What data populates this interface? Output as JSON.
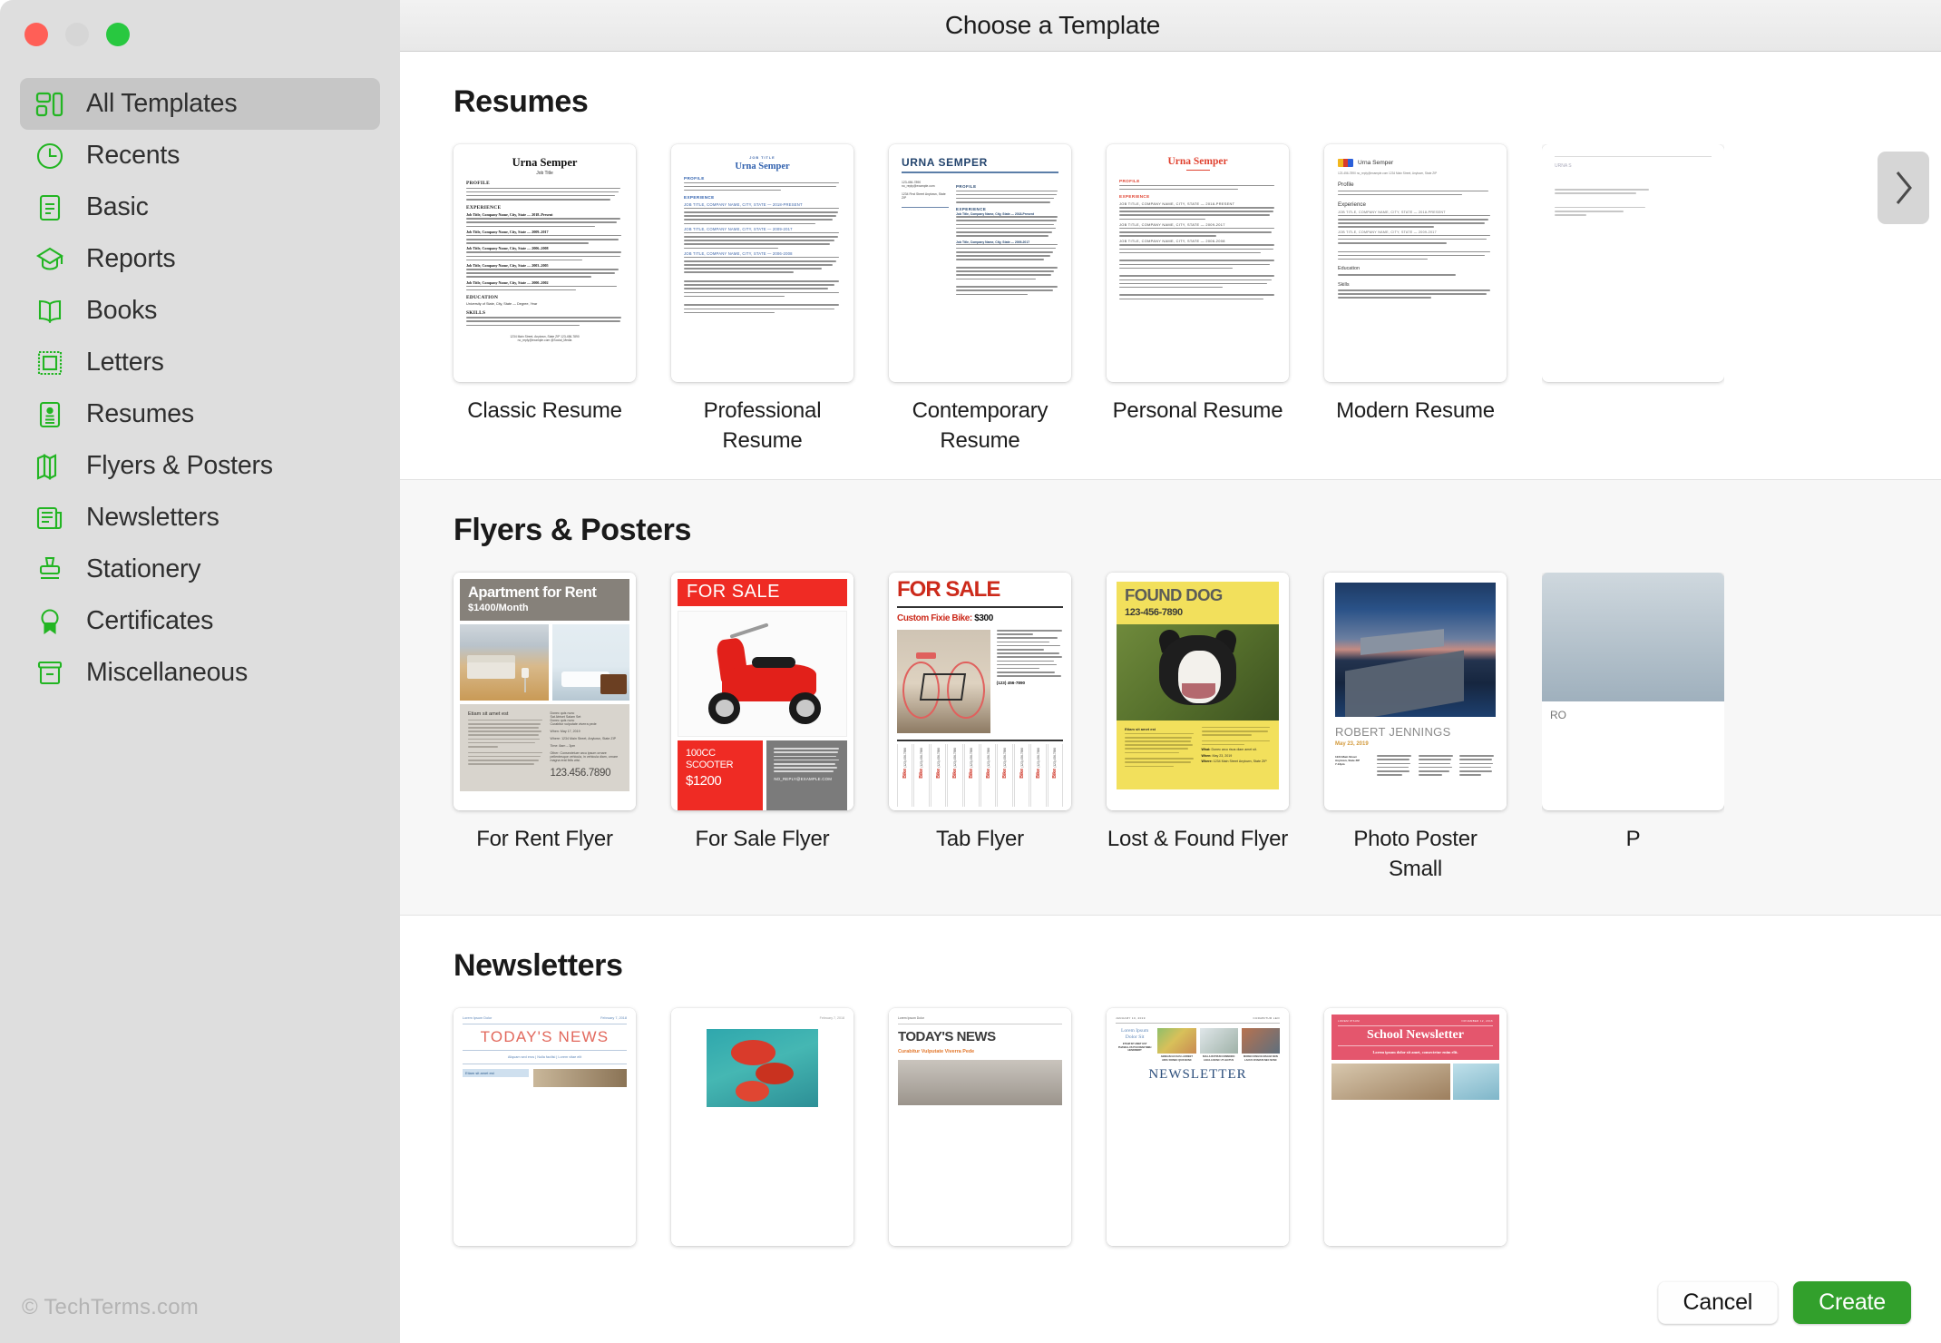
{
  "window": {
    "title": "Choose a Template",
    "traffic_lights": [
      "close",
      "minimize",
      "zoom"
    ],
    "watermark": "© TechTerms.com"
  },
  "sidebar": {
    "items": [
      {
        "label": "All Templates",
        "icon": "grid-icon",
        "active": true
      },
      {
        "label": "Recents",
        "icon": "clock-icon",
        "active": false
      },
      {
        "label": "Basic",
        "icon": "document-icon",
        "active": false
      },
      {
        "label": "Reports",
        "icon": "graduation-cap-icon",
        "active": false
      },
      {
        "label": "Books",
        "icon": "open-book-icon",
        "active": false
      },
      {
        "label": "Letters",
        "icon": "stamp-frame-icon",
        "active": false
      },
      {
        "label": "Resumes",
        "icon": "id-card-icon",
        "active": false
      },
      {
        "label": "Flyers & Posters",
        "icon": "folded-map-icon",
        "active": false
      },
      {
        "label": "Newsletters",
        "icon": "newspaper-icon",
        "active": false
      },
      {
        "label": "Stationery",
        "icon": "rubber-stamp-icon",
        "active": false
      },
      {
        "label": "Certificates",
        "icon": "award-ribbon-icon",
        "active": false
      },
      {
        "label": "Miscellaneous",
        "icon": "box-icon",
        "active": false
      }
    ],
    "accent_color": "#22b522"
  },
  "sections": [
    {
      "heading": "Resumes",
      "templates": [
        {
          "label": "Classic Resume"
        },
        {
          "label": "Professional Resume"
        },
        {
          "label": "Contemporary Resume"
        },
        {
          "label": "Personal Resume"
        },
        {
          "label": "Modern Resume"
        }
      ]
    },
    {
      "heading": "Flyers & Posters",
      "templates": [
        {
          "label": "For Rent Flyer"
        },
        {
          "label": "For Sale Flyer"
        },
        {
          "label": "Tab Flyer"
        },
        {
          "label": "Lost & Found Flyer"
        },
        {
          "label": "Photo Poster Small"
        }
      ]
    },
    {
      "heading": "Newsletters",
      "templates": [
        {
          "label": ""
        },
        {
          "label": ""
        },
        {
          "label": ""
        },
        {
          "label": ""
        },
        {
          "label": ""
        }
      ]
    }
  ],
  "thumbnails": {
    "classic_resume": {
      "name": "Urna Semper",
      "job_title": "Job Title",
      "sections": [
        "PROFILE",
        "EXPERIENCE",
        "EDUCATION",
        "SKILLS"
      ],
      "jobs": [
        "Job Title, Company Name, City, State — 2018–Present",
        "Job Title, Company Name, City, State — 2009–2017",
        "Job Title, Company Name, City, State — 2006–2008",
        "Job Title, Company Name, City, State — 2003–2005",
        "Job Title, Company Name, City, State — 2000–2002"
      ],
      "education": "University of State, City, State — Degree, Year",
      "footer_line1": "1234 Main Street, Anytown, State ZIP    123-456-7890",
      "footer_line2": "no_reply@example.com    @Social_Media"
    },
    "professional_resume": {
      "kicker": "JOB TITLE",
      "name": "Urna Semper",
      "sections": [
        "PROFILE",
        "EXPERIENCE"
      ],
      "jobs": [
        "JOB TITLE, COMPANY NAME, CITY, STATE — 2018-PRESENT",
        "JOB TITLE, COMPANY NAME, CITY, STATE — 2009-2017",
        "JOB TITLE, COMPANY NAME, CITY, STATE — 2006-2008"
      ],
      "accent": "#2e5fad"
    },
    "contemporary_resume": {
      "name": "URNA SEMPER",
      "phone": "123-456-7890",
      "email": "no_reply@example.com",
      "address": "1234 First Street Anytown, State ZIP",
      "sections": [
        "PROFILE",
        "EXPERIENCE"
      ],
      "jobs": [
        "Job Title, Company Name, City, State — 2018-Present",
        "Job Title, Company Name, City, State — 2009-2017"
      ],
      "accent": "#24456e"
    },
    "personal_resume": {
      "name": "Urna Semper",
      "sections": [
        "PROFILE",
        "EXPERIENCE"
      ],
      "jobs": [
        "JOB TITLE, COMPANY NAME, CITY, STATE — 2018-PRESENT",
        "JOB TITLE, COMPANY NAME, CITY, STATE — 2009-2017",
        "JOB TITLE, COMPANY NAME, CITY, STATE — 2006-2008"
      ],
      "accent": "#e0412f"
    },
    "modern_resume": {
      "name": "Urna Semper",
      "contact": "123-456-7890    no_reply@example.com    1234 Main Street, Anytown, State  ZIP",
      "sections": [
        "Profile",
        "Experience"
      ],
      "jobs": [
        "JOB TITLE, COMPANY NAME, CITY, STATE — 2018-PRESENT",
        "JOB TITLE, COMPANY NAME, CITY, STATE — 2009-2017"
      ],
      "logo_colors": [
        "#f2b71e",
        "#d93a2b",
        "#2b5fd9"
      ]
    },
    "for_rent_flyer": {
      "headline": "Apartment for Rent",
      "price": "$1400/Month",
      "body_heading": "Etiam sit amet est",
      "bullets": [
        "Donec quis nunc",
        "Sat Atriset Salam Set",
        "Donec quis nunc",
        "Curabitur vulputate viverra pede"
      ],
      "when_label": "When:",
      "when": "May 17, 2019",
      "where_label": "Where:",
      "where": "1234 Main Street, Anytown, State ZIP",
      "time_label": "Time:",
      "time": "8am – 3pm",
      "other_label": "Other:",
      "other": "Consectetuer arcu ipsum ornare pellentesque vehicula, in vehicula diam, ornare magna erat felis wisi.",
      "phone": "123.456.7890",
      "band_color": "#86817a"
    },
    "for_sale_flyer": {
      "headline": "FOR SALE",
      "title": "100CC SCOOTER",
      "price": "$1200",
      "email": "NO_REPLY@EXAMPLE.COM",
      "accent": "#ef2b24"
    },
    "tab_flyer": {
      "headline": "FOR SALE",
      "subhead_label": "Custom Fixie Bike:",
      "price": "$300",
      "phone": "(123) 456-7890",
      "tab_label": "Bike",
      "tab_phone": "(123) 456-7890",
      "tab_count": 10,
      "accent": "#cc2a1b"
    },
    "lost_found_flyer": {
      "headline": "FOUND DOG",
      "phone": "123-456-7890",
      "body_heading": "Etiam sit amet est",
      "what_label": "What:",
      "what": "Donec arcu risus diam amet sit.",
      "when_label": "When:",
      "when": "May 23, 2019",
      "where_label": "Where:",
      "where": "1234 Main Street Anytown, State ZIP",
      "band_color": "#f2e05c"
    },
    "photo_poster_small": {
      "name": "ROBERT JENNINGS",
      "date": "May 23, 2019",
      "address_line1": "1234 Main Street",
      "address_line2": "Anytown, State ZIP",
      "address_line3": "7-13pm",
      "accent": "#d39a3c"
    },
    "newsletter_1": {
      "kicker": "Lorem Ipsum Dolor",
      "date": "February 7, 2018",
      "title": "TODAY'S NEWS",
      "subhead": "Aliquam sed eros | Nulla facilisi | Lorem vitae elit",
      "callout": "Etiam sit amet est"
    },
    "newsletter_2": {
      "date": "February 7, 2018"
    },
    "newsletter_3": {
      "kicker": "Lorem Ipsum Dolor",
      "title": "TODAY'S NEWS",
      "subhead": "Curabitur Vulputate Viverra Pede"
    },
    "newsletter_4": {
      "date": "JANUARY 10, 2019",
      "kicker_right": "CURABITUR LEO",
      "lead": "Lorem Ipsum Dolor Sit",
      "captions": [
        "ETIAM SIT AMET EST PHASELLUS PULVINAR NIBH HENDRERIT",
        "AENEAN IACULIS LAOREET ARCU DONEC QUIS NUNC",
        "NULLA RUTRUM COMMODO LIGULA NUNC UT LECTUS",
        "MORBI CONGUE MAGNA NON LACUS VIVAMUS NEC NUNC"
      ],
      "big_title": "NEWSLETTER"
    },
    "newsletter_5": {
      "kicker": "LOREM IPSUM",
      "date": "NOVEMBER 12, 2016",
      "title": "School Newsletter",
      "subhead": "Lorem ipsum dolor sit amet, consectetur enim elit.",
      "band_color": "#e4566d"
    }
  },
  "controls": {
    "scroll_right_label": "›",
    "cancel_label": "Cancel",
    "create_label": "Create",
    "create_color": "#32a02c"
  }
}
